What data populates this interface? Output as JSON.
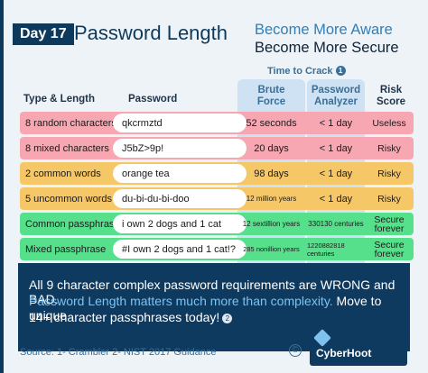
{
  "header": {
    "day_tag": "Day 17",
    "title": "Password Length",
    "slogan_1": "Become More Aware",
    "slogan_2": "Become More Secure"
  },
  "table": {
    "time_to_crack_label": "Time to Crack",
    "time_to_crack_footnote": "1",
    "columns": {
      "type": "Type & Length",
      "password": "Password",
      "brute_1": "Brute",
      "brute_2": "Force",
      "analyzer_1": "Password",
      "analyzer_2": "Analyzer",
      "risk_1": "Risk",
      "risk_2": "Score"
    },
    "rows": [
      {
        "type": "8 random characters",
        "password": "qkcrmztd",
        "brute": "52 seconds",
        "analyzer": "< 1 day",
        "risk": "Useless",
        "color": "#f7a7b2"
      },
      {
        "type": "8 mixed characters",
        "password": "J5bZ>9p!",
        "brute": "20 days",
        "analyzer": "< 1 day",
        "risk": "Risky",
        "color": "#f7a7b2"
      },
      {
        "type": "2 common words",
        "password": "orange tea",
        "brute": "98 days",
        "analyzer": "< 1 day",
        "risk": "Risky",
        "color": "#f6c767"
      },
      {
        "type": "5 uncommon words",
        "password": "du-bi-du-bi-doo",
        "brute": "12 million years",
        "analyzer": "< 1 day",
        "risk": "Risky",
        "color": "#f6c767"
      },
      {
        "type": "Common passphrase",
        "password": "i own 2 dogs and 1 cat",
        "brute": "12 sextillion years",
        "analyzer": "330130 centuries",
        "risk_1": "Secure",
        "risk_2": "forever",
        "color": "#56e08b"
      },
      {
        "type": "Mixed passphrase",
        "password": "#I own 2 dogs and 1 cat!?",
        "brute": "285 nonillion years",
        "analyzer": "1220882818 centuries",
        "risk_1": "Secure",
        "risk_2": "forever",
        "color": "#56e08b"
      }
    ]
  },
  "message": {
    "line1": "All 9 character complex password requirements are WRONG and BAD.",
    "line2_highlight": "Password Length matters much more than complexity.",
    "line2_rest": " Move to unique",
    "line3": "14+ character passphrases today!",
    "footnote": "2"
  },
  "footer": {
    "source": "Source: 1- Crambler   2- NIST 2017 Guidance",
    "copyright": "©",
    "logo": "CyberHoot"
  }
}
